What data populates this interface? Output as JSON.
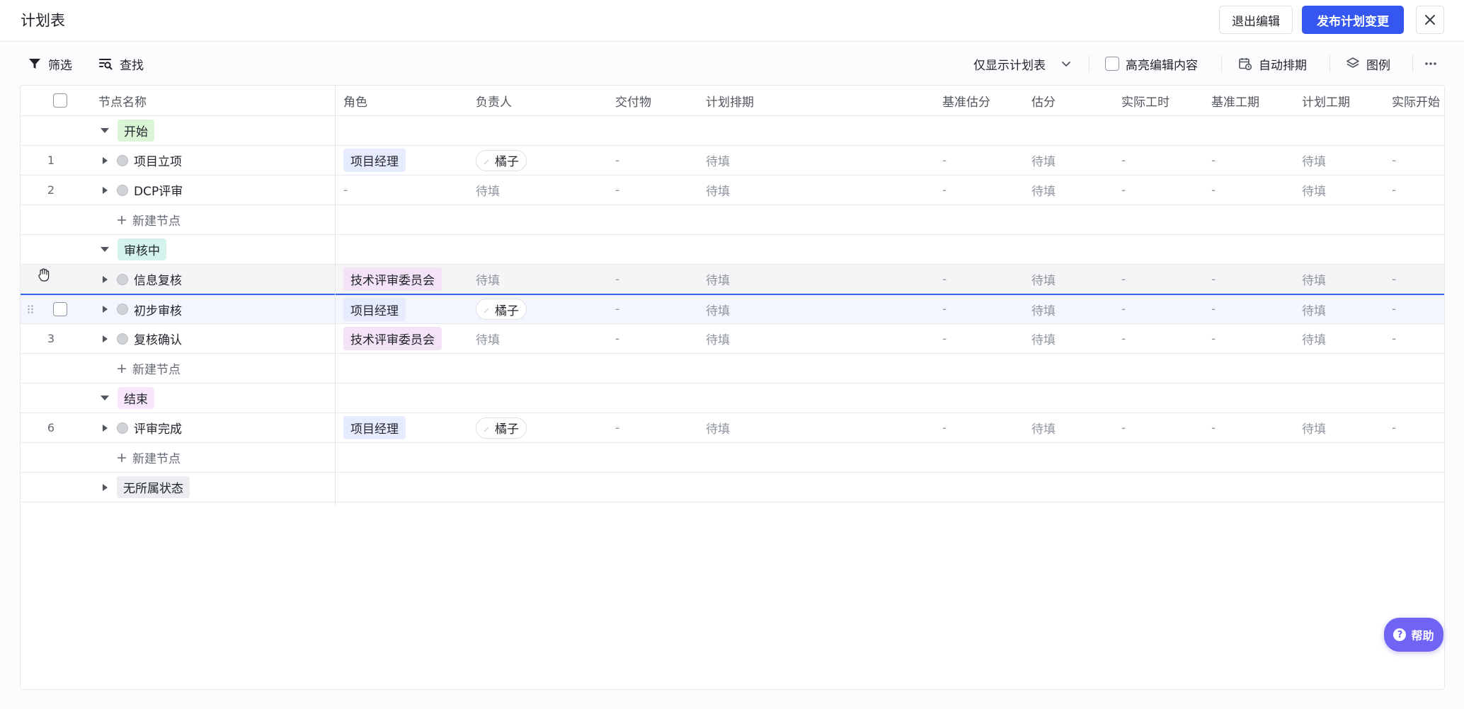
{
  "titlebar": {
    "title": "计划表",
    "exit_label": "退出编辑",
    "publish_label": "发布计划变更"
  },
  "toolbar": {
    "filter_label": "筛选",
    "search_label": "查找",
    "view_select_value": "仅显示计划表",
    "highlight_label": "高亮编辑内容",
    "auto_schedule_label": "自动排期",
    "legend_label": "图例"
  },
  "columns": [
    "节点名称",
    "角色",
    "负责人",
    "交付物",
    "计划排期",
    "基准估分",
    "估分",
    "实际工时",
    "基准工期",
    "计划工期",
    "实际开始"
  ],
  "groups": {
    "start": {
      "label": "开始"
    },
    "review": {
      "label": "审核中"
    },
    "end": {
      "label": "结束"
    },
    "none": {
      "label": "无所属状态"
    }
  },
  "add_node_label": "新建节点",
  "placeholder": "待填",
  "dash": "-",
  "rows": [
    {
      "num": "1",
      "name": "项目立项",
      "role": "项目经理",
      "owner": "橘子",
      "deliverable": "-",
      "schedule": "待填",
      "base_est": "-",
      "est": "待填",
      "actual_hours": "-",
      "base_duration": "-",
      "plan_duration": "待填",
      "actual_start": "-"
    },
    {
      "num": "2",
      "name": "DCP评审",
      "role": "-",
      "owner": "待填",
      "deliverable": "-",
      "schedule": "待填",
      "base_est": "-",
      "est": "待填",
      "actual_hours": "-",
      "base_duration": "-",
      "plan_duration": "待填",
      "actual_start": "-"
    },
    {
      "num": "",
      "name": "信息复核",
      "role": "技术评审委员会",
      "owner": "待填",
      "deliverable": "-",
      "schedule": "待填",
      "base_est": "-",
      "est": "待填",
      "actual_hours": "-",
      "base_duration": "-",
      "plan_duration": "待填",
      "actual_start": "-"
    },
    {
      "num": "",
      "name": "初步审核",
      "role": "项目经理",
      "owner": "橘子",
      "deliverable": "-",
      "schedule": "待填",
      "base_est": "-",
      "est": "待填",
      "actual_hours": "-",
      "base_duration": "-",
      "plan_duration": "待填",
      "actual_start": "-"
    },
    {
      "num": "3",
      "name": "复核确认",
      "role": "技术评审委员会",
      "owner": "待填",
      "deliverable": "-",
      "schedule": "待填",
      "base_est": "-",
      "est": "待填",
      "actual_hours": "-",
      "base_duration": "-",
      "plan_duration": "待填",
      "actual_start": "-"
    },
    {
      "num": "6",
      "name": "评审完成",
      "role": "项目经理",
      "owner": "橘子",
      "deliverable": "-",
      "schedule": "待填",
      "base_est": "-",
      "est": "待填",
      "actual_hours": "-",
      "base_duration": "-",
      "plan_duration": "待填",
      "actual_start": "-"
    }
  ],
  "help_label": "帮助",
  "colors": {
    "primary": "#3557f0",
    "help": "#7064f5",
    "selected_row": "#f3f6fe",
    "selected_border": "#3361e8"
  }
}
